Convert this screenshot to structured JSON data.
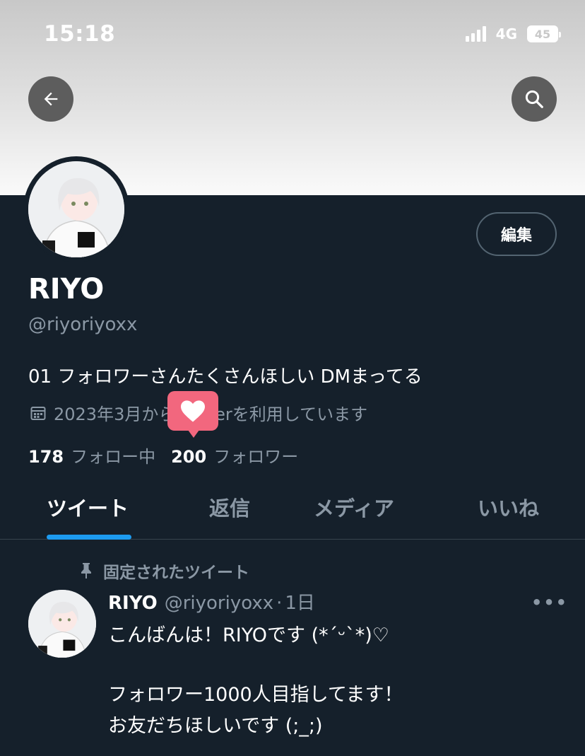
{
  "status": {
    "time": "15:18",
    "network": "4G",
    "battery": "45"
  },
  "profile": {
    "edit_label": "編集",
    "name": "RIYO",
    "handle": "@riyoriyoxx",
    "bio": "01 フォロワーさんたくさんほしい DMまってる",
    "joined": "2023年3月からTwitterを利用しています",
    "following_count": "178",
    "following_label": "フォロー中",
    "followers_count": "200",
    "followers_label": "フォロワー"
  },
  "tabs": [
    {
      "label": "ツイート"
    },
    {
      "label": "返信"
    },
    {
      "label": "メディア"
    },
    {
      "label": "いいね"
    }
  ],
  "tweet": {
    "pinned_label": "固定されたツイート",
    "name": "RIYO",
    "handle": "@riyoriyoxx",
    "dot": "·",
    "time": "1日",
    "more": "•••",
    "lines": [
      "こんばんは！RIYOです (*´ᵕ`*)♡",
      "フォロワー1000人目指してます！",
      "お友だちほしいです (;_;)"
    ]
  },
  "colors": {
    "background": "#15202b",
    "accent": "#1d9bf0",
    "secondary_text": "#8b98a5",
    "heart_badge": "#f2677e"
  },
  "icons": [
    "back-arrow-icon",
    "search-icon",
    "calendar-icon",
    "heart-icon",
    "pin-icon"
  ]
}
